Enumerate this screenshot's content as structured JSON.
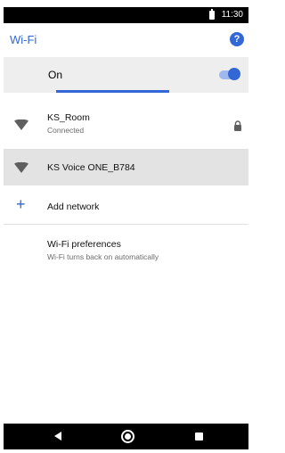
{
  "status_bar": {
    "time": "11:30"
  },
  "app_bar": {
    "title": "Wi-Fi",
    "help_icon": "?"
  },
  "wifi_switch": {
    "label": "On",
    "enabled": true
  },
  "networks": [
    {
      "name": "KS_Room",
      "status": "Connected",
      "secured": true
    },
    {
      "name": "KS Voice ONE_B784"
    }
  ],
  "add_network": {
    "label": "Add network"
  },
  "preferences": {
    "title": "Wi-Fi preferences",
    "subtitle": "Wi-Fi turns back on automatically"
  },
  "colors": {
    "accent": "#3367d6",
    "switch_bar": "#eeeeee",
    "selected_row": "#e3e3e3"
  }
}
